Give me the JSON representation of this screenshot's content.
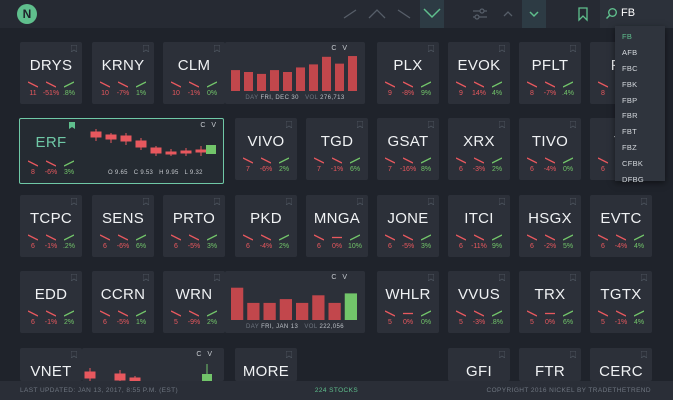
{
  "app": {
    "logo_letter": "N"
  },
  "search": {
    "value": "FB"
  },
  "dropdown": [
    "FB",
    "AFB",
    "FBC",
    "FBK",
    "FBP",
    "FBR",
    "FBT",
    "FBZ",
    "CFBK",
    "DFBG"
  ],
  "tiles": [
    {
      "sym": "DRYS",
      "d1": "11",
      "d5": "-51%",
      "d30": ".8%",
      "row": 0,
      "col": 0
    },
    {
      "sym": "KRNY",
      "d1": "10",
      "d5": "-7%",
      "d30": "1%",
      "row": 0,
      "col": 1
    },
    {
      "sym": "CLM",
      "d1": "10",
      "d5": "-1%",
      "d30": "0%",
      "row": 0,
      "col": 2
    },
    {
      "sym": "PLX",
      "d1": "9",
      "d5": "-8%",
      "d30": "9%",
      "row": 0,
      "col": 5
    },
    {
      "sym": "EVOK",
      "d1": "9",
      "d5": "14%",
      "d30": "4%",
      "row": 0,
      "col": 6
    },
    {
      "sym": "PFLT",
      "d1": "8",
      "d5": "-7%",
      "d30": ".4%",
      "row": 0,
      "col": 7
    },
    {
      "sym": "FN",
      "d1": "8",
      "d5": "",
      "d30": "",
      "row": 0,
      "col": 8
    },
    {
      "sym": "VIVO",
      "d1": "7",
      "d5": "-6%",
      "d30": "2%",
      "row": 1,
      "col": 3
    },
    {
      "sym": "TGD",
      "d1": "7",
      "d5": "-1%",
      "d30": "6%",
      "row": 1,
      "col": 4
    },
    {
      "sym": "GSAT",
      "d1": "7",
      "d5": "-16%",
      "d30": "8%",
      "row": 1,
      "col": 5
    },
    {
      "sym": "XRX",
      "d1": "6",
      "d5": "-3%",
      "d30": "2%",
      "row": 1,
      "col": 6
    },
    {
      "sym": "TIVO",
      "d1": "6",
      "d5": "-4%",
      "d30": "0%",
      "row": 1,
      "col": 7
    },
    {
      "sym": "TI",
      "d1": "6",
      "d5": "",
      "d30": "",
      "row": 1,
      "col": 8
    },
    {
      "sym": "TCPC",
      "d1": "6",
      "d5": "-1%",
      "d30": ".2%",
      "row": 2,
      "col": 0
    },
    {
      "sym": "SENS",
      "d1": "6",
      "d5": "-6%",
      "d30": "6%",
      "row": 2,
      "col": 1
    },
    {
      "sym": "PRTO",
      "d1": "6",
      "d5": "-5%",
      "d30": "3%",
      "row": 2,
      "col": 2
    },
    {
      "sym": "PKD",
      "d1": "6",
      "d5": "-4%",
      "d30": "2%",
      "row": 2,
      "col": 3
    },
    {
      "sym": "MNGA",
      "d1": "6",
      "d5": "0%",
      "d30": "10%",
      "row": 2,
      "col": 4
    },
    {
      "sym": "JONE",
      "d1": "6",
      "d5": "-5%",
      "d30": "3%",
      "row": 2,
      "col": 5
    },
    {
      "sym": "ITCI",
      "d1": "6",
      "d5": "-11%",
      "d30": "9%",
      "row": 2,
      "col": 6
    },
    {
      "sym": "HSGX",
      "d1": "6",
      "d5": "-2%",
      "d30": "5%",
      "row": 2,
      "col": 7
    },
    {
      "sym": "EVTC",
      "d1": "6",
      "d5": "-4%",
      "d30": "4%",
      "row": 2,
      "col": 8
    },
    {
      "sym": "EDD",
      "d1": "6",
      "d5": "-1%",
      "d30": "2%",
      "row": 3,
      "col": 0
    },
    {
      "sym": "CCRN",
      "d1": "6",
      "d5": "-5%",
      "d30": "1%",
      "row": 3,
      "col": 1
    },
    {
      "sym": "WRN",
      "d1": "5",
      "d5": "-9%",
      "d30": "2%",
      "row": 3,
      "col": 2
    },
    {
      "sym": "WHLR",
      "d1": "5",
      "d5": "0%",
      "d30": "0%",
      "row": 3,
      "col": 5
    },
    {
      "sym": "VVUS",
      "d1": "5",
      "d5": "-3%",
      "d30": ".8%",
      "row": 3,
      "col": 6
    },
    {
      "sym": "TRX",
      "d1": "5",
      "d5": "0%",
      "d30": "6%",
      "row": 3,
      "col": 7
    },
    {
      "sym": "TGTX",
      "d1": "5",
      "d5": "-1%",
      "d30": "4%",
      "row": 3,
      "col": 8
    },
    {
      "sym": "VNET",
      "d1": "",
      "d5": "",
      "d30": "",
      "row": 4,
      "col": 0
    },
    {
      "sym": "MORE",
      "d1": "",
      "d5": "",
      "d30": "",
      "row": 4,
      "col": 3
    },
    {
      "sym": "GFI",
      "d1": "",
      "d5": "",
      "d30": "",
      "row": 4,
      "col": 6
    },
    {
      "sym": "FTR",
      "d1": "",
      "d5": "",
      "d30": "",
      "row": 4,
      "col": 7
    },
    {
      "sym": "CERC",
      "d1": "",
      "d5": "",
      "d30": "",
      "row": 4,
      "col": 8
    }
  ],
  "focused": {
    "sym": "ERF",
    "d1": "8",
    "d5": "-6%",
    "d30": "3%",
    "cv": "C V",
    "ohlc": {
      "o": "O 9.65",
      "c": "C 9.53",
      "h": "H 9.95",
      "l": "L 9.32"
    }
  },
  "charts": [
    {
      "name": "chart-clm",
      "date_label": "DAY",
      "date": "FRI, DEC 30",
      "vol_label": "VOL",
      "vol": "276,713",
      "cv": "C V",
      "bars": [
        0.55,
        0.5,
        0.45,
        0.55,
        0.5,
        0.62,
        0.7,
        0.9,
        0.72,
        0.92
      ]
    },
    {
      "name": "chart-wrn",
      "date_label": "DAY",
      "date": "FRI, JAN 13",
      "vol_label": "VOL",
      "vol": "222,056",
      "cv": "C V",
      "bars": [
        0.85,
        0.45,
        0.45,
        0.55,
        0.45,
        0.65,
        0.45,
        0.7
      ]
    },
    {
      "name": "chart-vnet",
      "date_label": "",
      "date": "",
      "vol_label": "",
      "vol": "",
      "cv": "C V",
      "bars": []
    }
  ],
  "status": {
    "updated": "LAST UPDATED: JAN 13, 2017, 8:55 P.M. (EST)",
    "count": "224 STOCKS",
    "copyright": "COPYRIGHT 2016 NICKEL BY TRADETHETREND"
  },
  "colors": {
    "accent": "#5fbf8d",
    "red": "#e8585e",
    "green": "#72c56a",
    "bg": "#1f232b",
    "tile": "#2c3039"
  }
}
